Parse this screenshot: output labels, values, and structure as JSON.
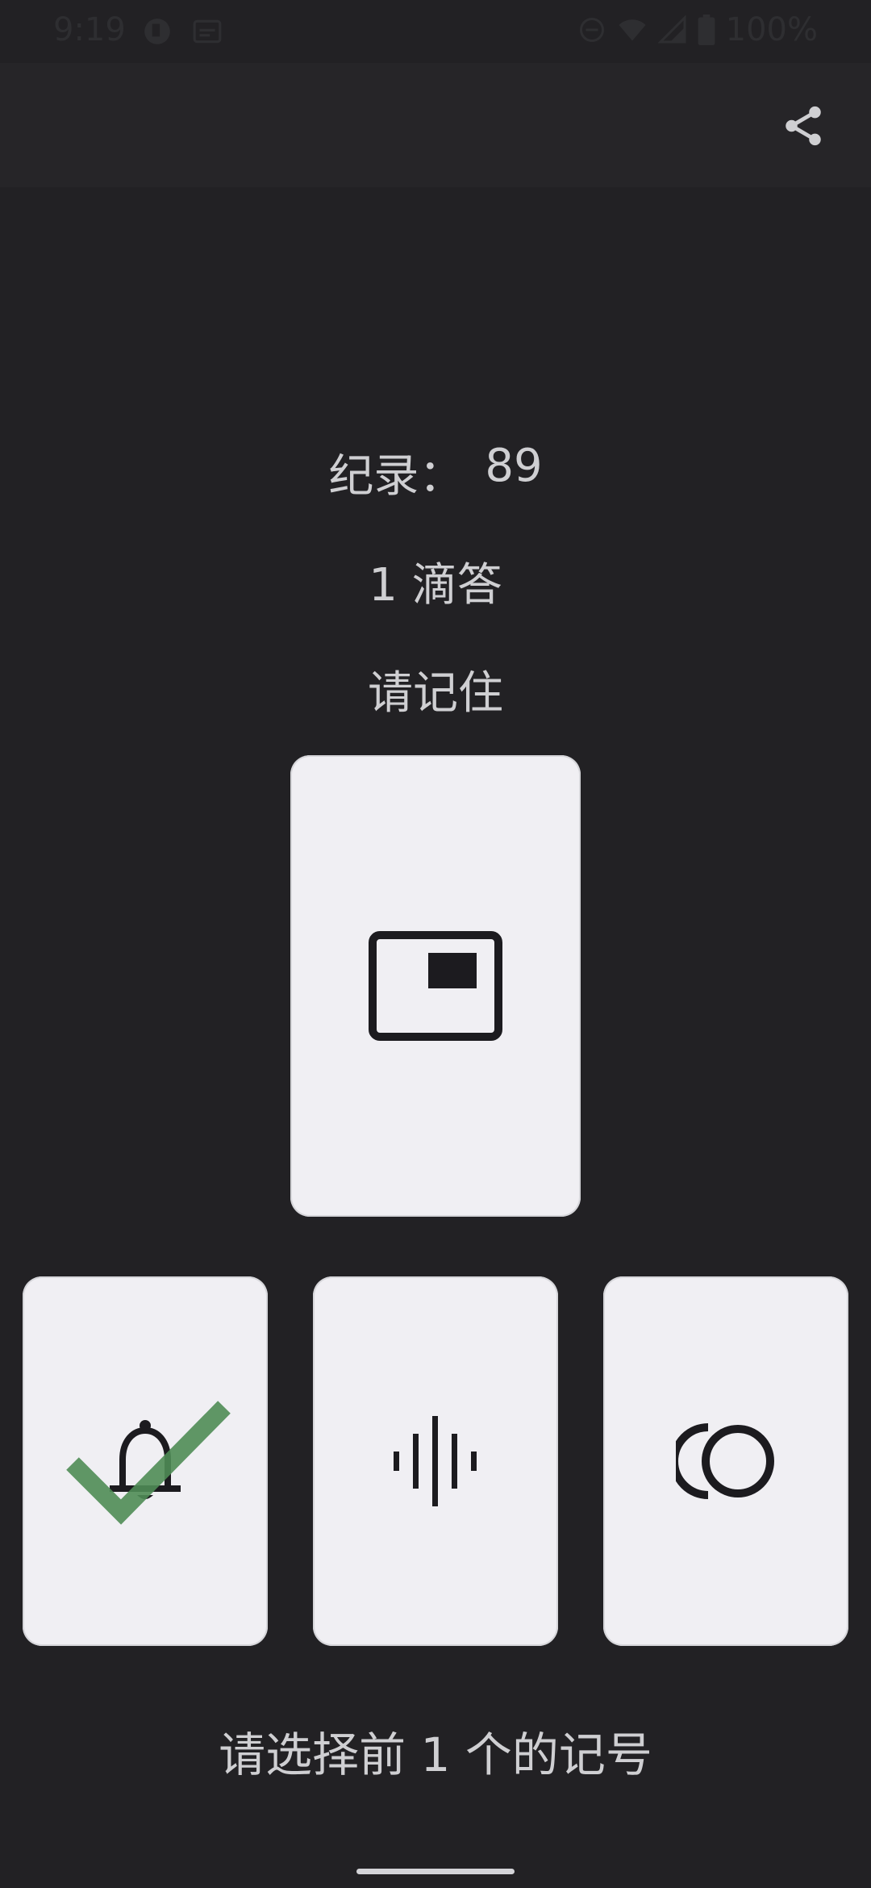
{
  "status_bar": {
    "time": "9:19",
    "battery": "100%",
    "icons": [
      "tilt-icon",
      "subtitles-icon",
      "do-not-disturb-icon",
      "wifi-icon",
      "signal-icon",
      "battery-icon"
    ]
  },
  "app_bar": {
    "share_icon": "share-icon"
  },
  "game": {
    "record_label": "纪录：",
    "record_value": "89",
    "ticks_text": "1 滴答",
    "memorize_text": "请记住",
    "target_symbol": "picture-in-picture-icon",
    "choices": [
      {
        "symbol": "bell-icon",
        "marked_correct": true
      },
      {
        "symbol": "graphic-eq-icon",
        "marked_correct": false
      },
      {
        "symbol": "contrast-circle-icon",
        "marked_correct": false
      }
    ],
    "select_prompt": "请选择前 1 个的记号"
  },
  "colors": {
    "background": "#222124",
    "app_bar": "#262528",
    "card": "#f0eff3",
    "text": "#cfcfd2",
    "check": "#4f8c55"
  }
}
